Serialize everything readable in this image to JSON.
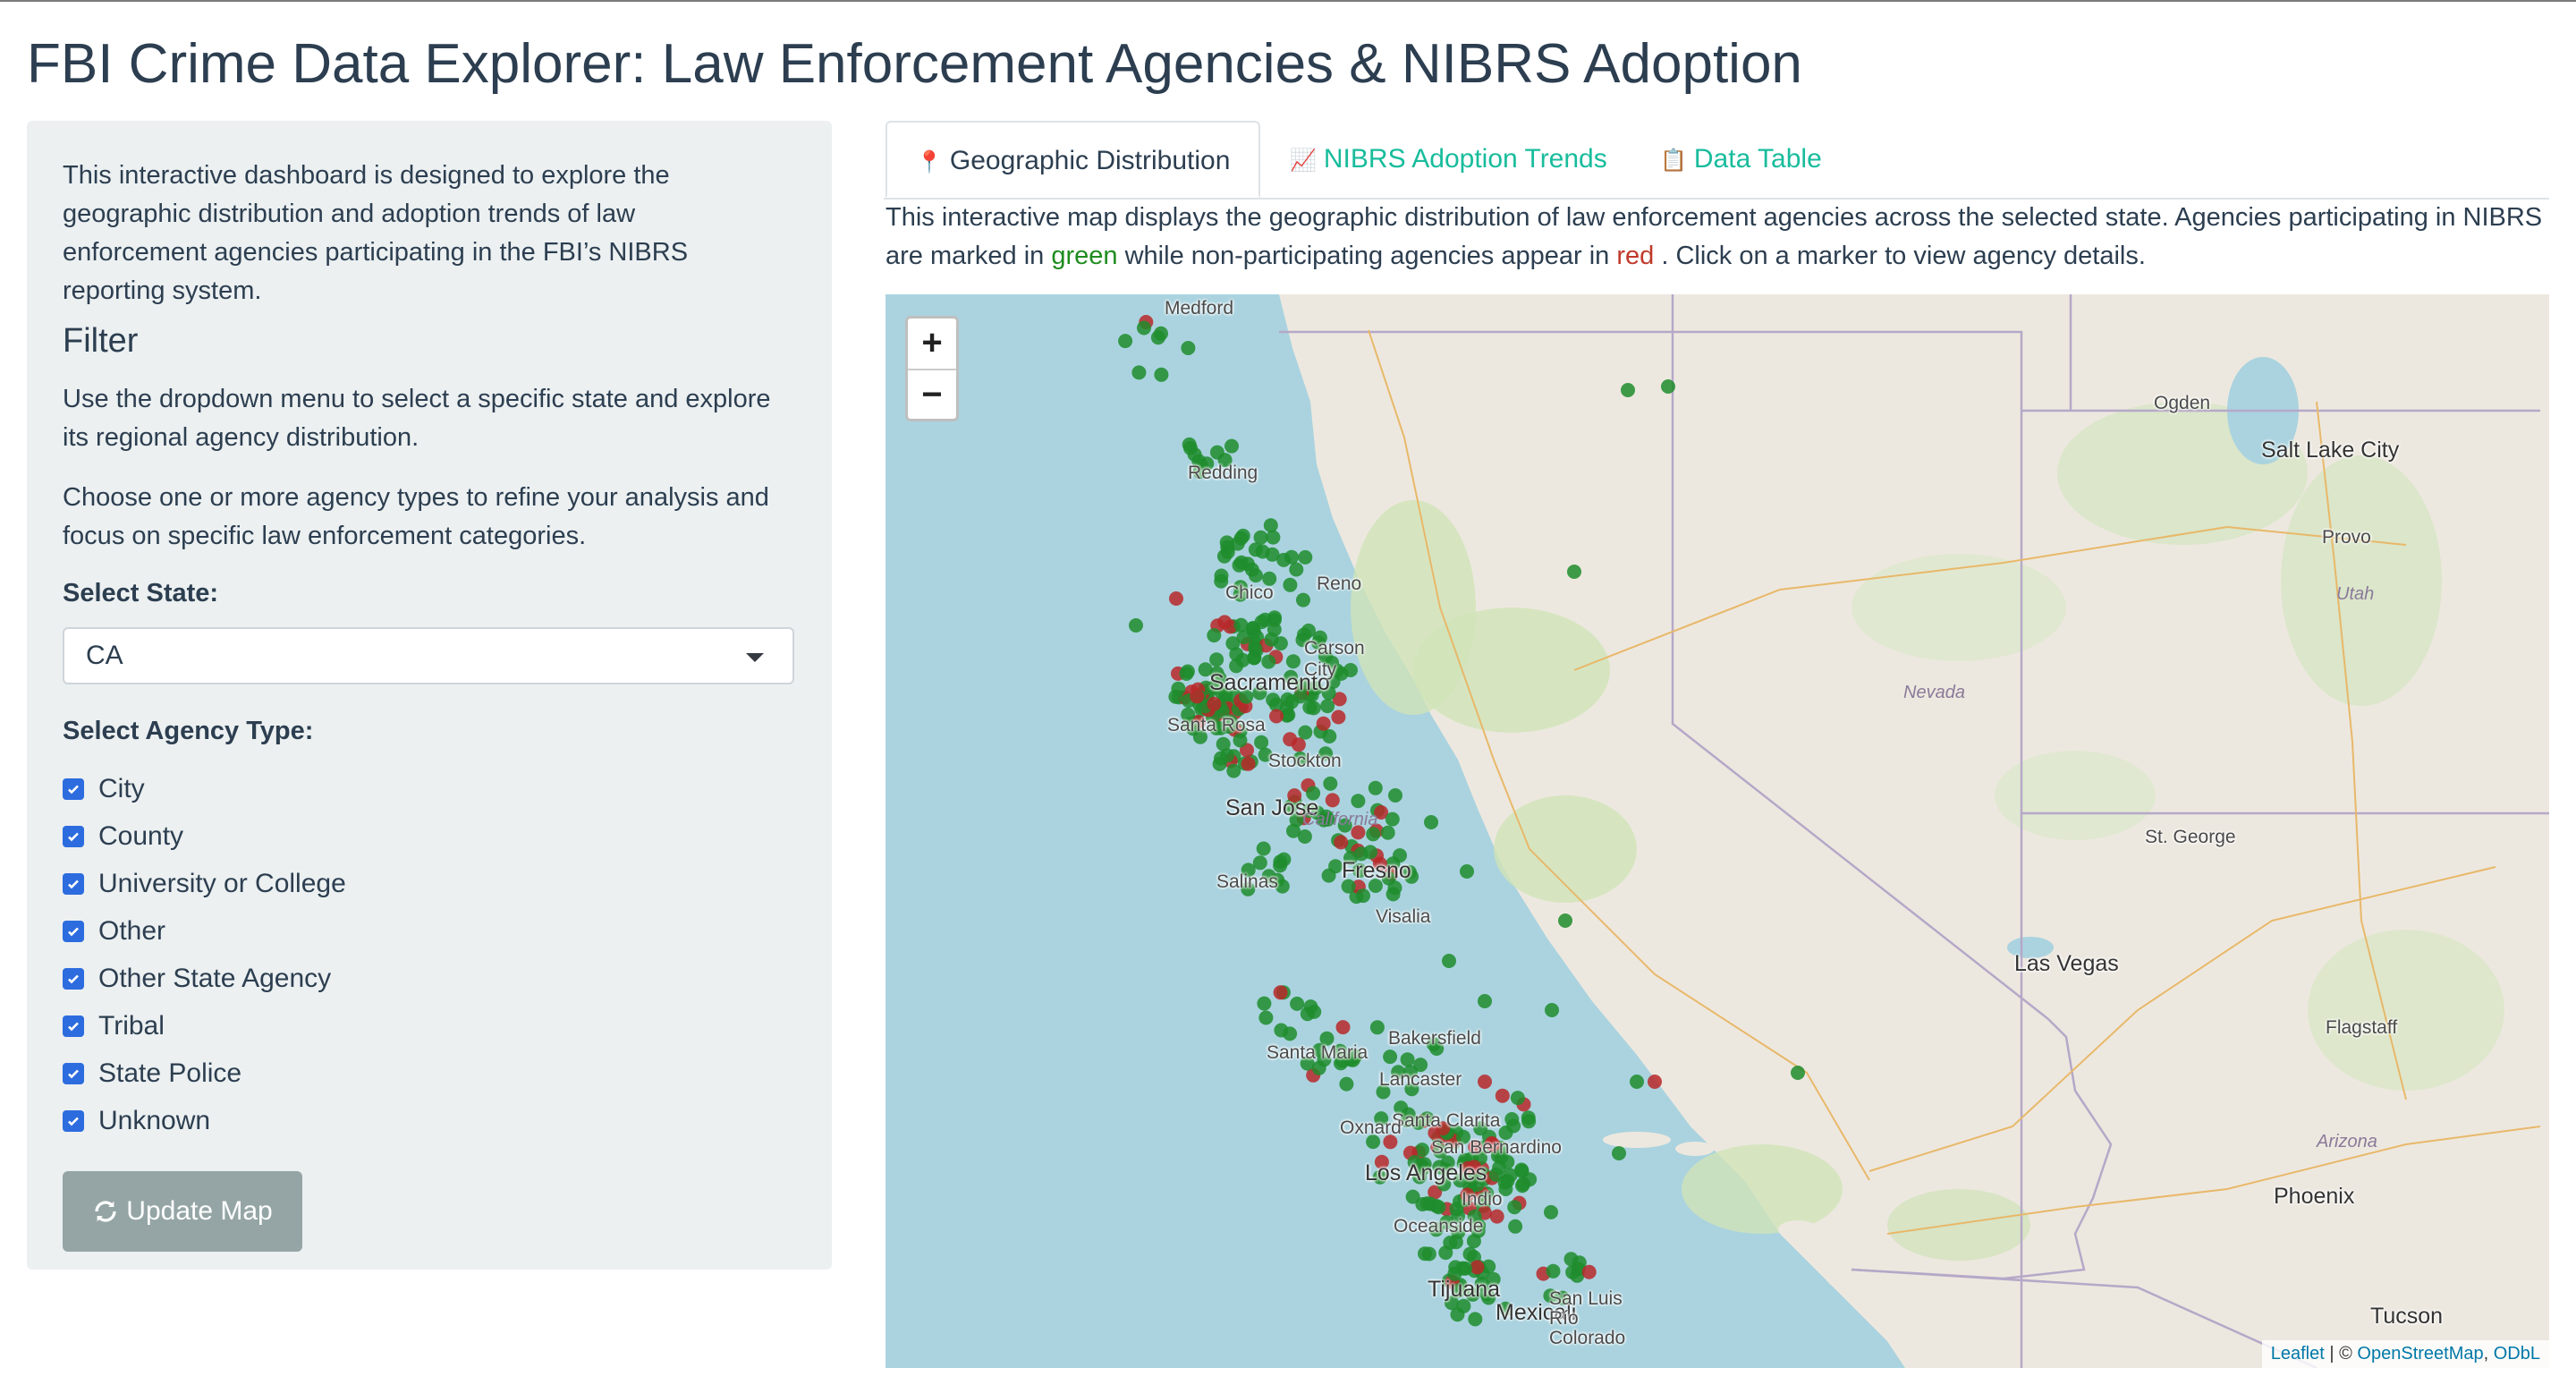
{
  "page": {
    "title": "FBI Crime Data Explorer: Law Enforcement Agencies & NIBRS Adoption"
  },
  "sidebar": {
    "intro": "This interactive dashboard is designed to explore the geographic distribution and adoption trends of law enforcement agencies participating in the FBI’s NIBRS reporting system.",
    "filter_heading": "Filter",
    "state_help": "Use the dropdown menu to select a specific state and explore its regional agency distribution.",
    "agency_help": "Choose one or more agency types to refine your analysis and focus on specific law enforcement categories.",
    "select_state_label": "Select State:",
    "selected_state": "CA",
    "agency_type_label": "Select Agency Type:",
    "agency_types": [
      {
        "label": "City",
        "checked": true
      },
      {
        "label": "County",
        "checked": true
      },
      {
        "label": "University or College",
        "checked": true
      },
      {
        "label": "Other",
        "checked": true
      },
      {
        "label": "Other State Agency",
        "checked": true
      },
      {
        "label": "Tribal",
        "checked": true
      },
      {
        "label": "State Police",
        "checked": true
      },
      {
        "label": "Unknown",
        "checked": true
      }
    ],
    "update_button": "Update Map",
    "update_icon": "refresh-icon"
  },
  "tabs": [
    {
      "label": "Geographic Distribution",
      "icon": "📍",
      "active": true
    },
    {
      "label": "NIBRS Adoption Trends",
      "icon": "📈",
      "active": false
    },
    {
      "label": "Data Table",
      "icon": "📋",
      "active": false
    }
  ],
  "description": {
    "part1": "This interactive map displays the geographic distribution of law enforcement agencies across the selected state. Agencies participating in NIBRS are marked in",
    "green_word": "green",
    "part2": "while non-participating agencies appear in",
    "red_word": "red",
    "part3": ". Click on a marker to view agency details."
  },
  "map": {
    "zoom_in": "+",
    "zoom_out": "−",
    "attribution_leaflet": "Leaflet",
    "attribution_sep": " | © ",
    "attribution_osm": "OpenStreetMap",
    "attribution_comma": ", ",
    "attribution_odbl": "ODbL",
    "colors": {
      "participating": "#1e8c2d",
      "non_participating": "#b8282a",
      "ocean": "#aad3df",
      "land": "#ede8df",
      "green_area": "#cfe3b8"
    },
    "cities": [
      "Medford",
      "Redding",
      "Chico",
      "Sacramento",
      "Santa Rosa",
      "San Jose",
      "Stockton",
      "Salinas",
      "Fresno",
      "Visalia",
      "Santa Maria",
      "Bakersfield",
      "Lancaster",
      "Santa Clarita",
      "Oxnard",
      "Los Angeles",
      "San Bernardino",
      "Indio",
      "Oceanside",
      "Tijuana",
      "Mexicali",
      "San Luis Río Colorado",
      "Reno",
      "Carson City",
      "Ogden",
      "Salt Lake City",
      "Provo",
      "St. George",
      "Las Vegas",
      "Flagstaff",
      "Phoenix",
      "Tucson"
    ],
    "regions": [
      "Utah",
      "Nevada",
      "California",
      "Arizona"
    ]
  }
}
